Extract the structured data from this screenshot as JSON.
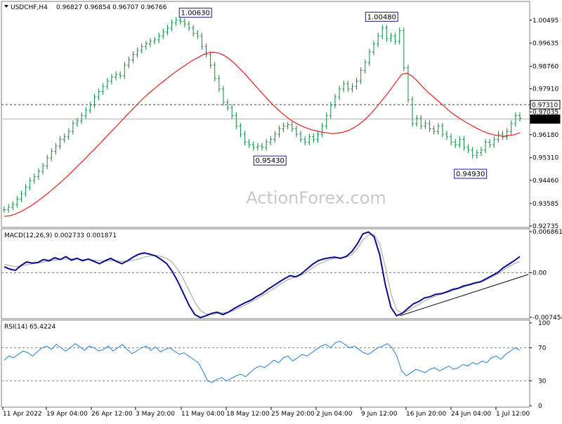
{
  "header": {
    "symbol_label": "USDCHF,H4",
    "ohlc_label": "0.96827 0.96854 0.96707 0.96766"
  },
  "watermark": "ActionForex.com",
  "colors": {
    "price_bars": "#0b8a3c",
    "moving_average": "#e02020",
    "macd_line": "#0a0a8c",
    "signal_line": "#a0a0a0",
    "rsi_line": "#1e7fd6",
    "reference_lines": "#404040",
    "frame": "#808080"
  },
  "chart_data": [
    {
      "type": "line",
      "pane": "price",
      "title": "USDCHF,H4",
      "subtitle": "0.96827 0.96854 0.96707 0.96766",
      "ylim": [
        0.92735,
        1.0078
      ],
      "y_ticks": [
        "1.00495",
        "0.99635",
        "0.98760",
        "0.97910",
        "0.97035",
        "0.96180",
        "0.95310",
        "0.94460",
        "0.93585",
        "0.92735"
      ],
      "x_tick_labels": [
        "11 Apr 2022",
        "19 Apr 04:00",
        "26 Apr 12:00",
        "3 May 20:00",
        "11 May 04:00",
        "18 May 12:00",
        "25 May 20:00",
        "2 Jun 04:00",
        "9 Jun 12:00",
        "16 Jun 20:00",
        "24 Jun 04:00",
        "1 Jul 12:00"
      ],
      "x": [
        0,
        5,
        10,
        15,
        20,
        25,
        30,
        35,
        40,
        45,
        50,
        55,
        60,
        65,
        70,
        75,
        80,
        85,
        90,
        95,
        100,
        105,
        110,
        115,
        120,
        125,
        130,
        135,
        140,
        145,
        150,
        155,
        160,
        165,
        170,
        175,
        180,
        185,
        190,
        195,
        200,
        205,
        210,
        215,
        220,
        225,
        230,
        235,
        240,
        245,
        250,
        255,
        260,
        265,
        270,
        275,
        280,
        285,
        290,
        295,
        300,
        305,
        310,
        315,
        320,
        325,
        330,
        335,
        340,
        345,
        350,
        355,
        360,
        365,
        370,
        375,
        380,
        385,
        390,
        395,
        400,
        405,
        410,
        415,
        420,
        425,
        430,
        435,
        440,
        445,
        450,
        455,
        460,
        465,
        470,
        475,
        480,
        485,
        490,
        495,
        500,
        505,
        510,
        515,
        520,
        525,
        530,
        535,
        540,
        545,
        550,
        555,
        560,
        565,
        570,
        575,
        580,
        585,
        590,
        595,
        600,
        605,
        610,
        615,
        620,
        625,
        630,
        635,
        640,
        645,
        650,
        655,
        660,
        665,
        670,
        675,
        680,
        685,
        690,
        695,
        700,
        705,
        710,
        715,
        720,
        725,
        730,
        735,
        740
      ],
      "series": [
        {
          "name": "USDCHF H4",
          "values": [
            0.9335,
            0.9345,
            0.9355,
            0.9375,
            0.9395,
            0.942,
            0.9445,
            0.946,
            0.948,
            0.95,
            0.953,
            0.9555,
            0.9575,
            0.96,
            0.961,
            0.963,
            0.966,
            0.967,
            0.969,
            0.971,
            0.973,
            0.976,
            0.978,
            0.98,
            0.982,
            0.9835,
            0.9845,
            0.984,
            0.988,
            0.99,
            0.992,
            0.9935,
            0.995,
            0.996,
            0.997,
            0.9975,
            0.999,
            1.0005,
            1.002,
            1.004,
            1.005,
            1.0045,
            1.0035,
            1.002,
            1.0,
            0.999,
            0.995,
            0.992,
            0.988,
            0.983,
            0.979,
            0.974,
            0.972,
            0.969,
            0.965,
            0.962,
            0.959,
            0.958,
            0.957,
            0.9575,
            0.957,
            0.959,
            0.96,
            0.962,
            0.964,
            0.965,
            0.9655,
            0.964,
            0.962,
            0.96,
            0.959,
            0.961,
            0.96,
            0.962,
            0.965,
            0.969,
            0.973,
            0.976,
            0.979,
            0.981,
            0.979,
            0.98,
            0.982,
            0.986,
            0.989,
            0.993,
            0.996,
            0.999,
            1.002,
            0.998,
            0.999,
            0.997,
            1.001,
            0.987,
            0.975,
            0.966,
            0.968,
            0.965,
            0.966,
            0.964,
            0.963,
            0.965,
            0.962,
            0.961,
            0.959,
            0.958,
            0.96,
            0.957,
            0.956,
            0.954,
            0.955,
            0.956,
            0.959,
            0.958,
            0.96,
            0.962,
            0.961,
            0.963,
            0.966,
            0.969,
            0.968
          ],
          "ohlc_note": "",
          "color": "#0b8a3c"
        },
        {
          "name": "Moving Average",
          "values": [
            0.931,
            0.9312,
            0.9318,
            0.9327,
            0.9338,
            0.935,
            0.9364,
            0.9379,
            0.9395,
            0.9412,
            0.9429,
            0.9447,
            0.9466,
            0.9486,
            0.9506,
            0.9526,
            0.9547,
            0.9567,
            0.9588,
            0.961,
            0.9631,
            0.9652,
            0.9674,
            0.9695,
            0.9716,
            0.9737,
            0.9757,
            0.9775,
            0.9792,
            0.9809,
            0.9825,
            0.9841,
            0.9856,
            0.987,
            0.9884,
            0.9897,
            0.9908,
            0.9919,
            0.9927,
            0.9929,
            0.9925,
            0.9916,
            0.9902,
            0.9884,
            0.9864,
            0.9843,
            0.982,
            0.9797,
            0.9775,
            0.9752,
            0.9731,
            0.9712,
            0.9694,
            0.9678,
            0.9665,
            0.9654,
            0.9645,
            0.9638,
            0.9633,
            0.9628,
            0.9625,
            0.9622,
            0.9623,
            0.9627,
            0.9633,
            0.9643,
            0.9656,
            0.9672,
            0.9692,
            0.9714,
            0.9739,
            0.9764,
            0.979,
            0.9818,
            0.9845,
            0.985,
            0.9838,
            0.9818,
            0.9796,
            0.9776,
            0.9759,
            0.9741,
            0.9723,
            0.9705,
            0.969,
            0.9677,
            0.9664,
            0.9653,
            0.9642,
            0.9632,
            0.9624,
            0.9618,
            0.9614,
            0.9612,
            0.9615,
            0.9618,
            0.9625
          ],
          "color": "#e02020"
        }
      ],
      "annotations": [
        {
          "text": "1.00630",
          "x": 67,
          "y": 1.0063
        },
        {
          "text": "1.00480",
          "x": 132,
          "y": 1.0048
        },
        {
          "text": "0.95430",
          "x": 93,
          "y": 0.9543
        },
        {
          "text": "0.94930",
          "x": 163,
          "y": 0.9493
        }
      ],
      "horizontal_lines": [
        {
          "label": "0.97310",
          "value": 0.9731,
          "style": "dashed"
        },
        {
          "label": "0.96766",
          "value": 0.96766,
          "style": "current",
          "color": "#000000"
        }
      ]
    },
    {
      "type": "line",
      "pane": "macd",
      "title": "MACD(12,26,9) 0.002733 0.001871",
      "ylim": [
        -0.007454,
        0.006861
      ],
      "y_ticks": [
        "0.006861",
        "0.00",
        "-0.007454"
      ],
      "series": [
        {
          "name": "MACD",
          "color": "#0a0a8c",
          "values": [
            0.001,
            0.0006,
            0.0004,
            0.0012,
            0.0018,
            0.0016,
            0.0017,
            0.0022,
            0.002,
            0.0025,
            0.0022,
            0.0027,
            0.0021,
            0.0024,
            0.002,
            0.0023,
            0.0019,
            0.0015,
            0.002,
            0.0024,
            0.0019,
            0.0015,
            0.002,
            0.0026,
            0.0031,
            0.0033,
            0.0031,
            0.0028,
            0.0022,
            0.0015,
            0.0002,
            -0.0015,
            -0.0035,
            -0.0055,
            -0.007,
            -0.0075,
            -0.0072,
            -0.0068,
            -0.0066,
            -0.007,
            -0.0066,
            -0.006,
            -0.0055,
            -0.005,
            -0.0046,
            -0.004,
            -0.0035,
            -0.0028,
            -0.0022,
            -0.0016,
            -0.001,
            -0.0005,
            -0.0007,
            -0.0002,
            0.0006,
            0.0014,
            0.002,
            0.0023,
            0.0025,
            0.0026,
            0.0024,
            0.0027,
            0.0035,
            0.0048,
            0.0065,
            0.0068,
            0.006,
            0.003,
            -0.002,
            -0.0058,
            -0.0072,
            -0.0068,
            -0.006,
            -0.0052,
            -0.0048,
            -0.0042,
            -0.004,
            -0.0036,
            -0.0035,
            -0.0032,
            -0.0028,
            -0.0026,
            -0.0022,
            -0.002,
            -0.0017,
            -0.0015,
            -0.001,
            -0.0005,
            0.0,
            0.0008,
            0.0014,
            0.002,
            0.0027
          ]
        },
        {
          "name": "Signal",
          "color": "#a0a0a0",
          "values": [
            0.0014,
            0.0012,
            0.001,
            0.0011,
            0.0013,
            0.0015,
            0.0016,
            0.0018,
            0.0019,
            0.0021,
            0.0022,
            0.0023,
            0.0023,
            0.0023,
            0.0022,
            0.0022,
            0.0021,
            0.002,
            0.0019,
            0.002,
            0.002,
            0.0019,
            0.0019,
            0.0021,
            0.0023,
            0.0026,
            0.0028,
            0.0029,
            0.0027,
            0.0024,
            0.0017,
            0.0005,
            -0.0011,
            -0.003,
            -0.0049,
            -0.0063,
            -0.0069,
            -0.007,
            -0.0068,
            -0.0067,
            -0.0066,
            -0.0063,
            -0.0059,
            -0.0054,
            -0.0049,
            -0.0044,
            -0.0039,
            -0.0033,
            -0.0027,
            -0.0021,
            -0.0015,
            -0.001,
            -0.0007,
            -0.0004,
            0.0001,
            0.0008,
            0.0014,
            0.0018,
            0.0022,
            0.0024,
            0.0025,
            0.0026,
            0.003,
            0.004,
            0.0055,
            0.0063,
            0.0064,
            0.0048,
            0.001,
            -0.0035,
            -0.0062,
            -0.0068,
            -0.0064,
            -0.0058,
            -0.0053,
            -0.0047,
            -0.0043,
            -0.0039,
            -0.0036,
            -0.0033,
            -0.003,
            -0.0027,
            -0.0024,
            -0.0021,
            -0.0018,
            -0.0016,
            -0.0012,
            -0.0007,
            -0.0003,
            0.0004,
            0.001,
            0.0015,
            0.0019
          ]
        }
      ],
      "trendline": {
        "from": [
          140,
          -0.0072
        ],
        "to": [
          183,
          -0.0003
        ]
      }
    },
    {
      "type": "line",
      "pane": "rsi",
      "title": "RSI(14) 65.4224",
      "ylim": [
        0,
        100
      ],
      "y_ticks": [
        "100",
        "70",
        "30",
        "0"
      ],
      "reference_levels": [
        70,
        30
      ],
      "series": [
        {
          "name": "RSI(14)",
          "color": "#1e7fd6",
          "values": [
            55,
            60,
            58,
            62,
            66,
            64,
            60,
            65,
            70,
            72,
            68,
            74,
            70,
            66,
            70,
            75,
            71,
            67,
            72,
            70,
            66,
            68,
            72,
            66,
            70,
            74,
            68,
            63,
            66,
            70,
            72,
            67,
            71,
            65,
            68,
            70,
            66,
            62,
            64,
            60,
            56,
            52,
            42,
            30,
            28,
            32,
            34,
            30,
            33,
            36,
            38,
            35,
            40,
            45,
            48,
            46,
            50,
            55,
            52,
            58,
            60,
            54,
            58,
            62,
            60,
            64,
            68,
            72,
            74,
            70,
            76,
            78,
            74,
            70,
            72,
            68,
            64,
            62,
            66,
            70,
            72,
            75,
            70,
            60,
            42,
            36,
            40,
            44,
            42,
            40,
            44,
            46,
            42,
            45,
            48,
            44,
            46,
            50,
            48,
            52,
            50,
            54,
            52,
            58,
            60,
            56,
            62,
            66,
            70,
            67
          ],
          "note": ""
        }
      ]
    }
  ]
}
